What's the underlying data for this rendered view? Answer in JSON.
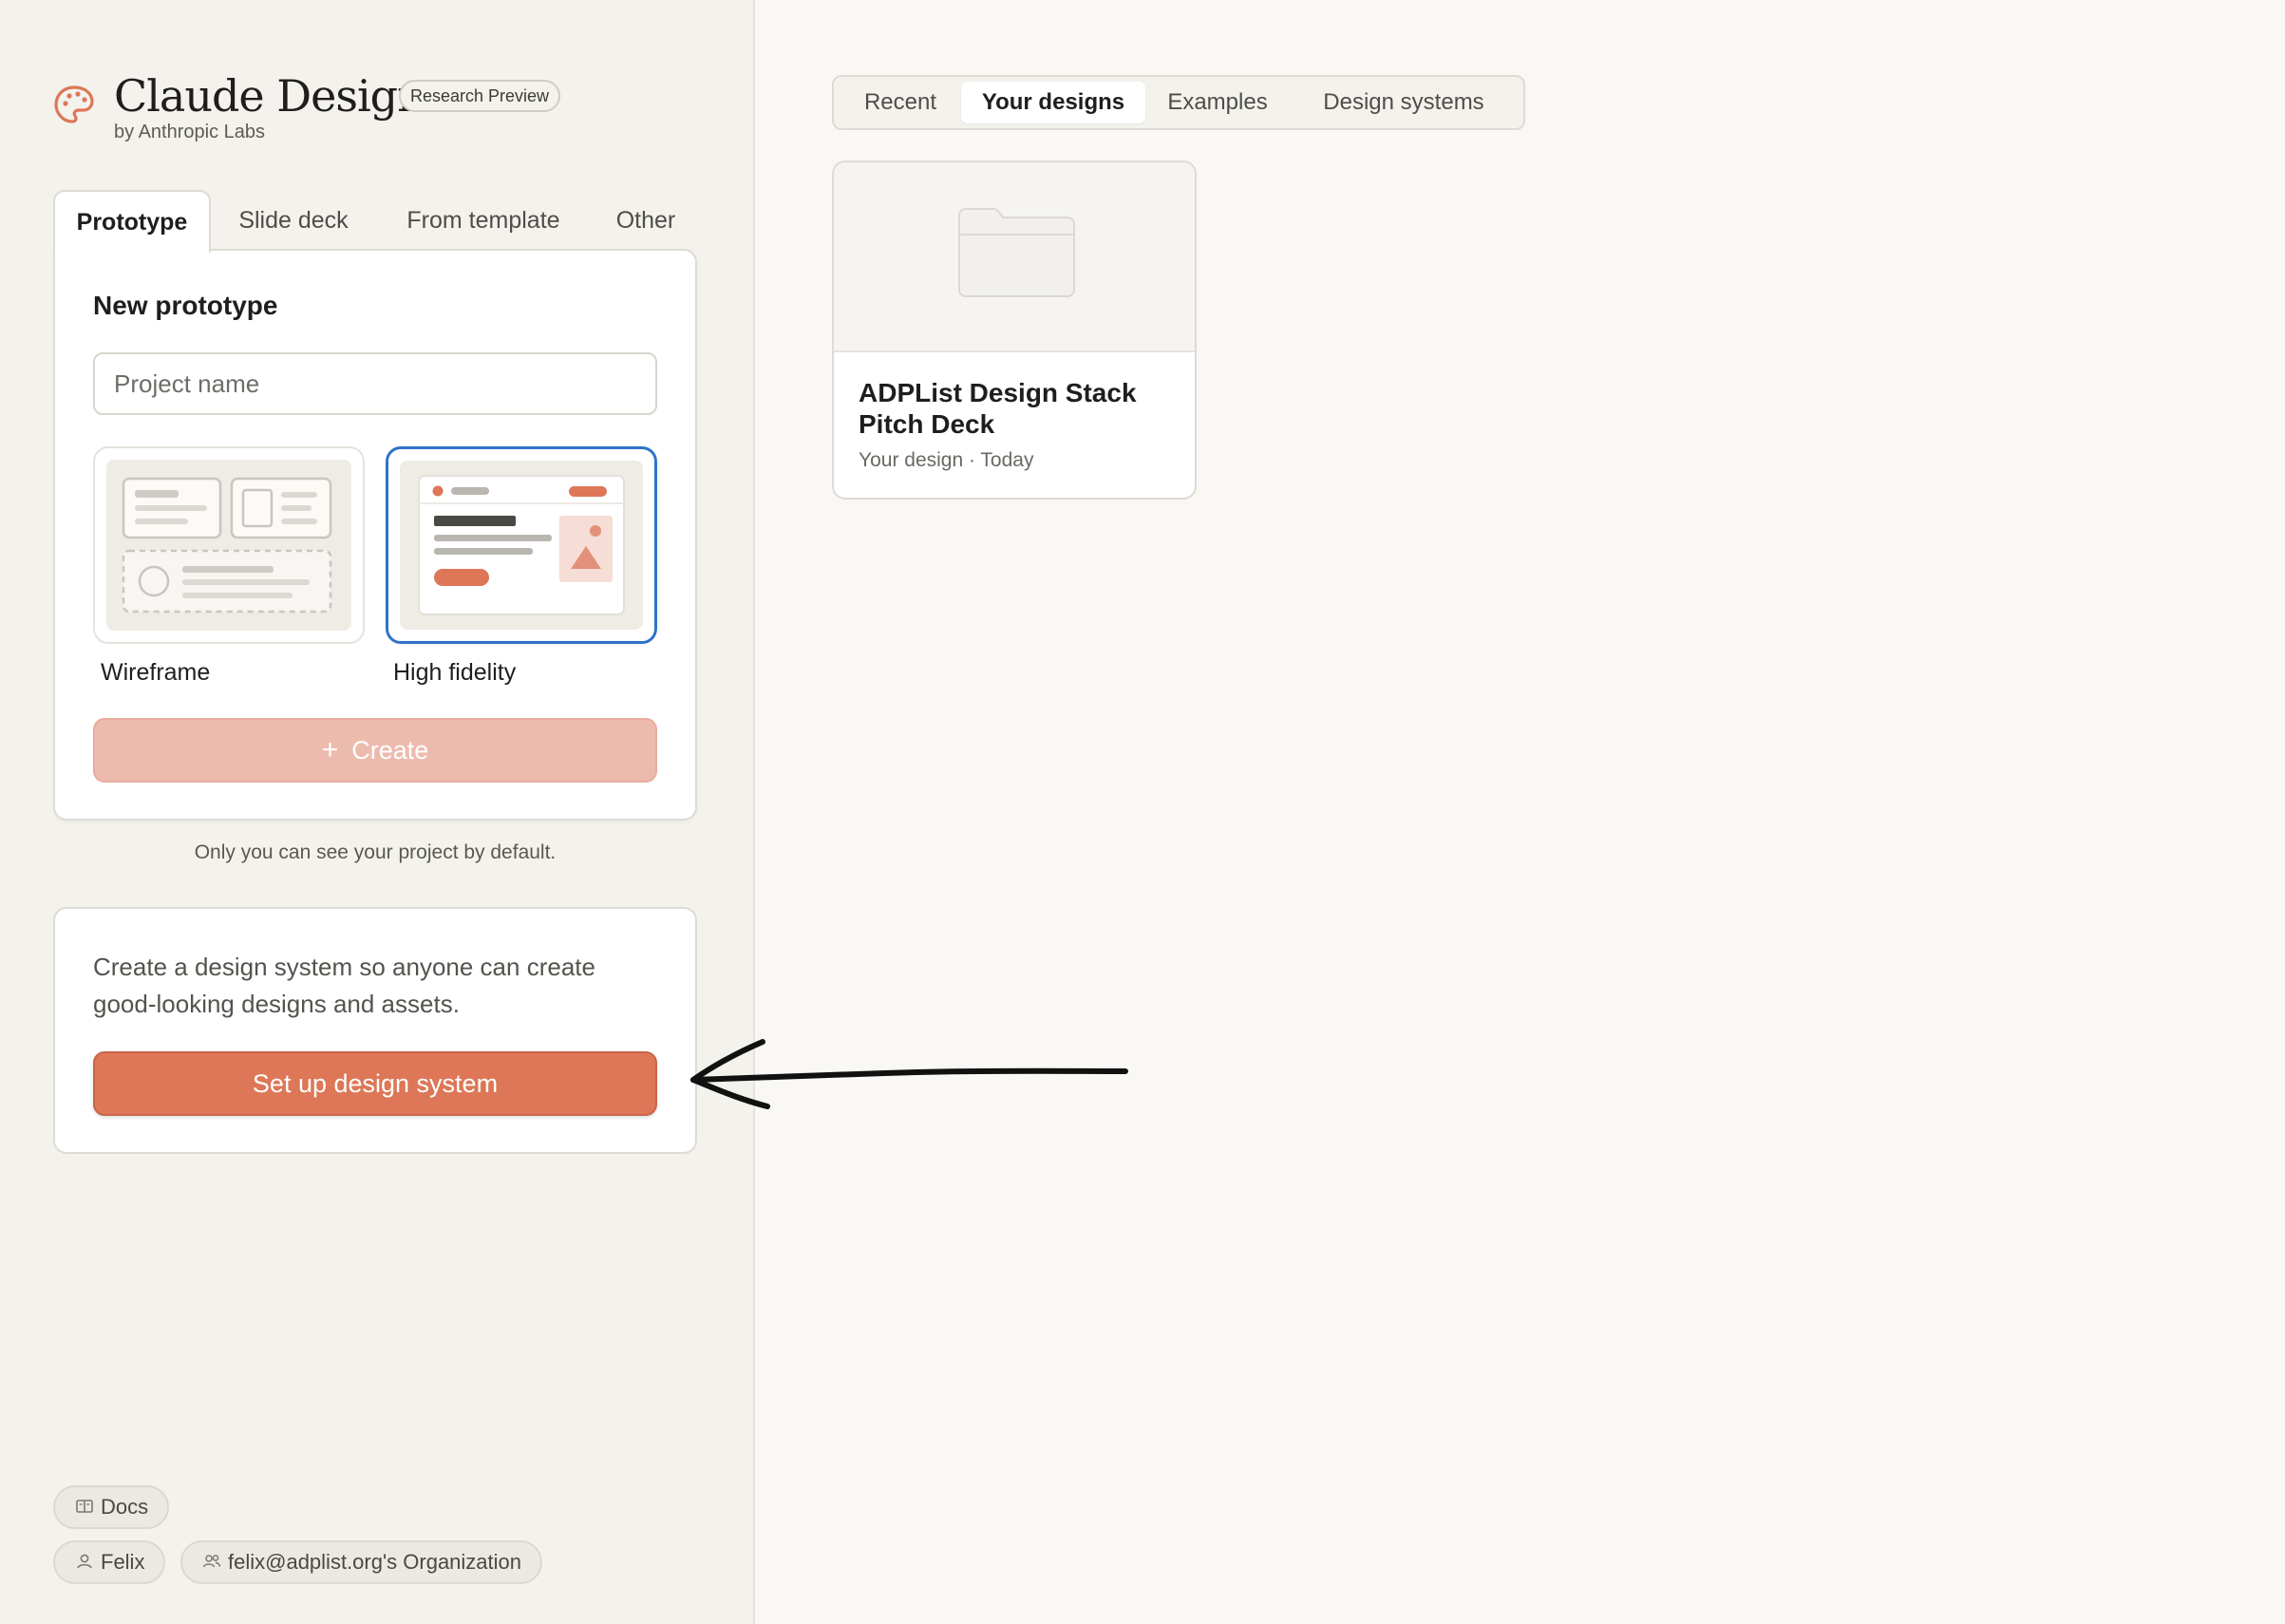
{
  "brand": {
    "title": "Claude Design",
    "badge": "Research Preview",
    "subtitle": "by Anthropic Labs",
    "accent_color": "#dd7757"
  },
  "create_tabs": [
    {
      "label": "Prototype",
      "active": true
    },
    {
      "label": "Slide deck",
      "active": false
    },
    {
      "label": "From template",
      "active": false
    },
    {
      "label": "Other",
      "active": false
    }
  ],
  "new_prototype": {
    "title": "New prototype",
    "project_name_placeholder": "Project name",
    "project_name_value": "",
    "options": [
      {
        "label": "Wireframe",
        "selected": false
      },
      {
        "label": "High fidelity",
        "selected": true
      }
    ],
    "create_label": "Create",
    "create_icon": "plus-icon"
  },
  "visibility_note": "Only you can see your project by default.",
  "design_system_card": {
    "text": "Create a design system so anyone can create good-looking designs and assets.",
    "button_label": "Set up design system"
  },
  "footer": {
    "docs_label": "Docs",
    "user_label": "Felix",
    "org_label": "felix@adplist.org's Organization"
  },
  "browse_tabs": [
    {
      "label": "Recent",
      "active": false
    },
    {
      "label": "Your designs",
      "active": true
    },
    {
      "label": "Examples",
      "active": false
    },
    {
      "label": "Design systems",
      "active": false
    }
  ],
  "designs": [
    {
      "title": "ADPList Design Stack Pitch Deck",
      "meta": "Your design · Today",
      "thumb_icon": "folder-icon"
    }
  ],
  "colors": {
    "selected_border": "#2f73c9",
    "create_disabled": "#edbbae",
    "primary_button": "#dd7757"
  }
}
